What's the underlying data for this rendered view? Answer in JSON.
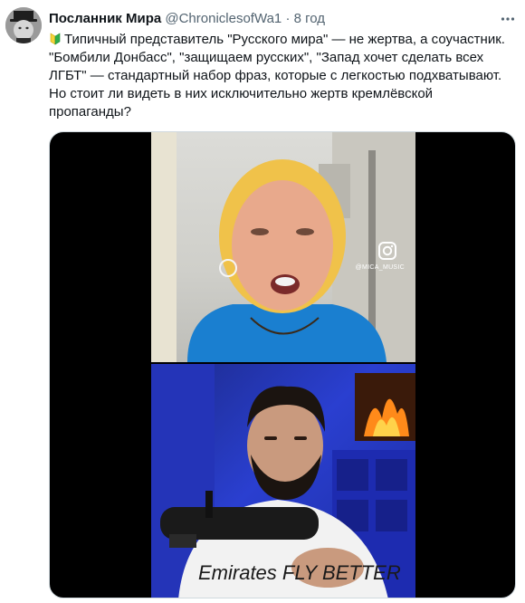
{
  "tweet": {
    "author_name": "Посланник Мира",
    "author_handle": "@ChroniclesofWa1",
    "separator": "·",
    "timestamp": "8 год",
    "text_lines": [
      "Типичный представитель \"Русского мира\" — не жертва, а соучастник.",
      "\"Бомбили Донбасс\", \"защищаем русских\", \"Запад хочет сделать всех",
      "ЛГБТ\" — стандартный набор фраз, которые с легкостью подхватывают.",
      "Но стоит ли видеть в них исключительно жертв кремлёвской",
      "пропаганды?"
    ]
  },
  "media": {
    "watermark": "@MICA_MUSIC",
    "shirt_text": "Emirates FLY BETTER"
  },
  "icons": {
    "more": "more-horizontal-icon",
    "badge": "beginner-badge-icon",
    "instagram": "instagram-icon"
  },
  "colors": {
    "text": "#0f1419",
    "secondary": "#536471",
    "badge_green": "#2fae4a",
    "badge_yellow": "#f5d33b"
  }
}
